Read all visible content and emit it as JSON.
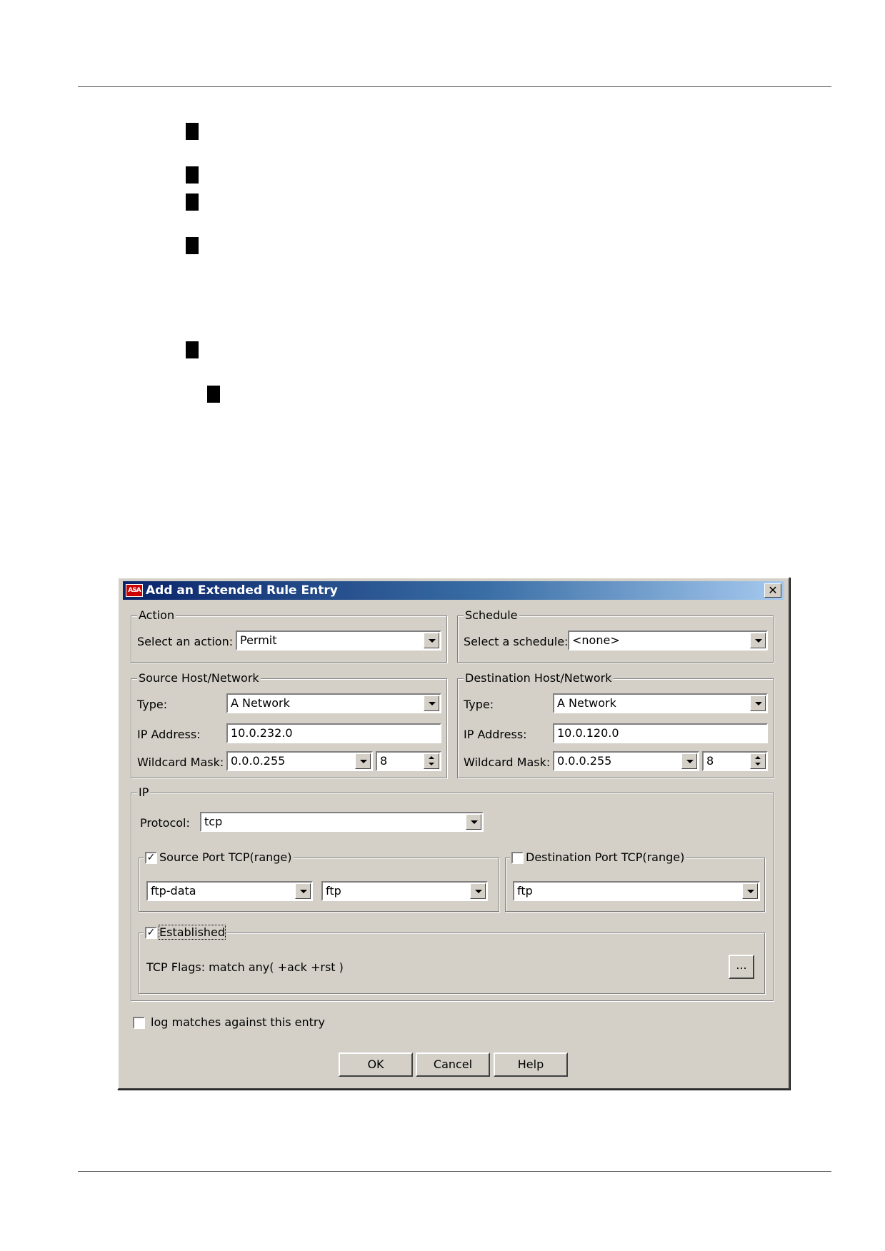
{
  "dialog": {
    "title": "Add an Extended Rule Entry",
    "icon_text": "ASA",
    "close_label": "✕",
    "action": {
      "legend": "Action",
      "label": "Select an action:",
      "value": "Permit"
    },
    "schedule": {
      "legend": "Schedule",
      "label": "Select a schedule:",
      "value": "<none>"
    },
    "source": {
      "legend": "Source Host/Network",
      "type_label": "Type:",
      "type_value": "A Network",
      "ip_label": "IP Address:",
      "ip_value": "10.0.232.0",
      "mask_label": "Wildcard Mask:",
      "mask_value": "0.0.0.255",
      "bits_value": "8"
    },
    "destination": {
      "legend": "Destination Host/Network",
      "type_label": "Type:",
      "type_value": "A Network",
      "ip_label": "IP Address:",
      "ip_value": "10.0.120.0",
      "mask_label": "Wildcard Mask:",
      "mask_value": "0.0.0.255",
      "bits_value": "8"
    },
    "ip": {
      "legend": "IP",
      "protocol_label": "Protocol:",
      "protocol_value": "tcp",
      "source_port": {
        "label": "Source Port TCP(range)",
        "checked": true,
        "from": "ftp-data",
        "to": "ftp"
      },
      "dest_port": {
        "label": "Destination Port TCP(range)",
        "checked": false,
        "value": "ftp"
      },
      "established": {
        "label": "Established",
        "checked": true,
        "flags_text": "TCP Flags: match any( +ack +rst )",
        "more_label": "..."
      }
    },
    "log_label": "log matches against this entry",
    "log_checked": false,
    "buttons": {
      "ok": "OK",
      "cancel": "Cancel",
      "help": "Help"
    }
  }
}
